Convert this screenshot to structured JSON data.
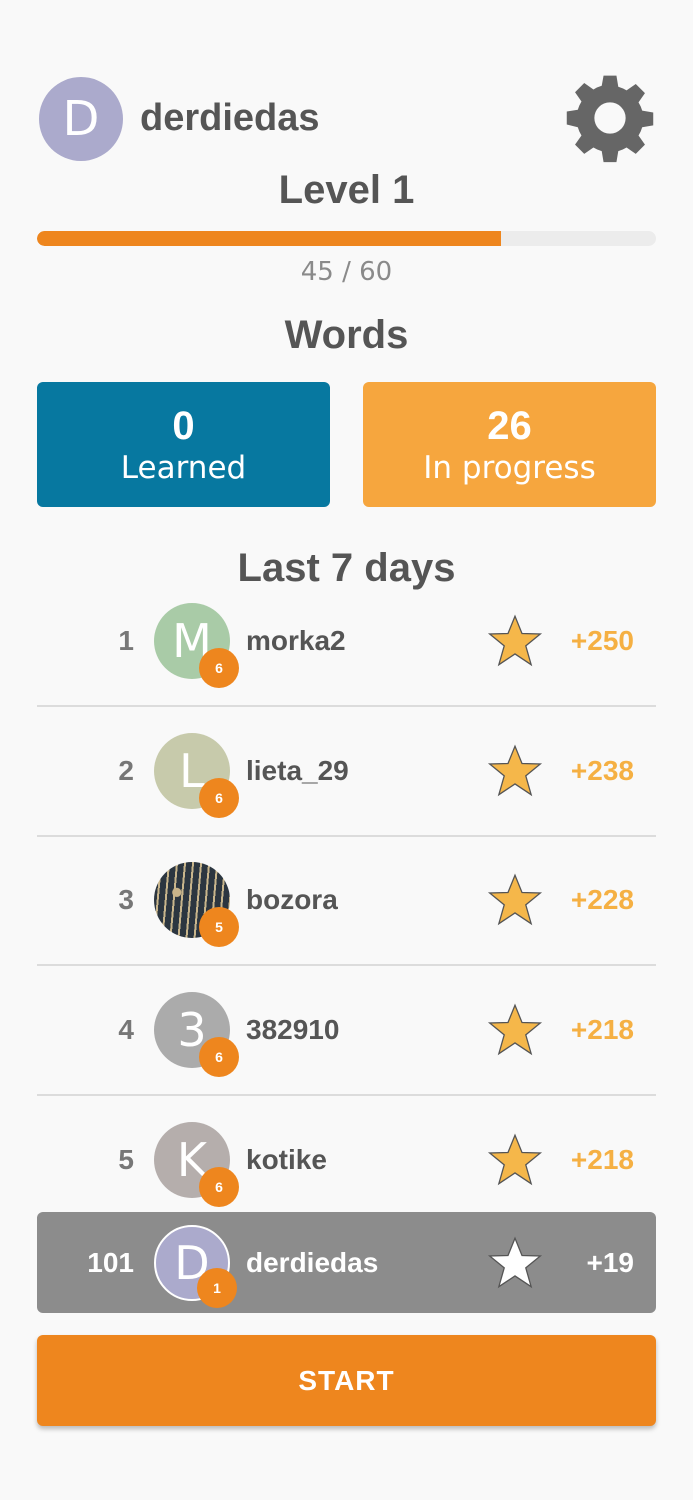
{
  "colors": {
    "accent": "#ee861e",
    "learned": "#0778a0",
    "in_progress": "#f6a63e",
    "star": "#f5b74a",
    "points": "#f5b043",
    "current_user_row": "#8c8c8c"
  },
  "profile": {
    "avatar_letter": "D",
    "avatar_color": "#abaacc",
    "username": "derdiedas",
    "settings_icon": "gear-icon"
  },
  "level": {
    "title": "Level 1",
    "progress_text": "45 / 60",
    "progress_fraction": 0.75
  },
  "words": {
    "title": "Words",
    "learned": {
      "count": "0",
      "label": "Learned"
    },
    "in_progress": {
      "count": "26",
      "label": "In progress"
    }
  },
  "leaderboard": {
    "title": "Last 7 days",
    "rows": [
      {
        "rank": "1",
        "avatar_letter": "M",
        "avatar_color": "#a9cba7",
        "level_badge": "6",
        "name": "morka2",
        "points": "+250"
      },
      {
        "rank": "2",
        "avatar_letter": "L",
        "avatar_color": "#c7caab",
        "level_badge": "6",
        "name": "lieta_29",
        "points": "+238"
      },
      {
        "rank": "3",
        "avatar_letter": "",
        "avatar_photo": true,
        "avatar_color": "#2e3a44",
        "level_badge": "5",
        "name": "bozora",
        "points": "+228"
      },
      {
        "rank": "4",
        "avatar_letter": "3",
        "avatar_color": "#ababab",
        "level_badge": "6",
        "name": "382910",
        "points": "+218"
      },
      {
        "rank": "5",
        "avatar_letter": "K",
        "avatar_color": "#b5aeac",
        "level_badge": "6",
        "name": "kotike",
        "points": "+218"
      }
    ],
    "current_user": {
      "rank": "101",
      "avatar_letter": "D",
      "avatar_color": "#abaacc",
      "level_badge": "1",
      "name": "derdiedas",
      "points": "+19"
    }
  },
  "start_button": {
    "label": "START"
  }
}
